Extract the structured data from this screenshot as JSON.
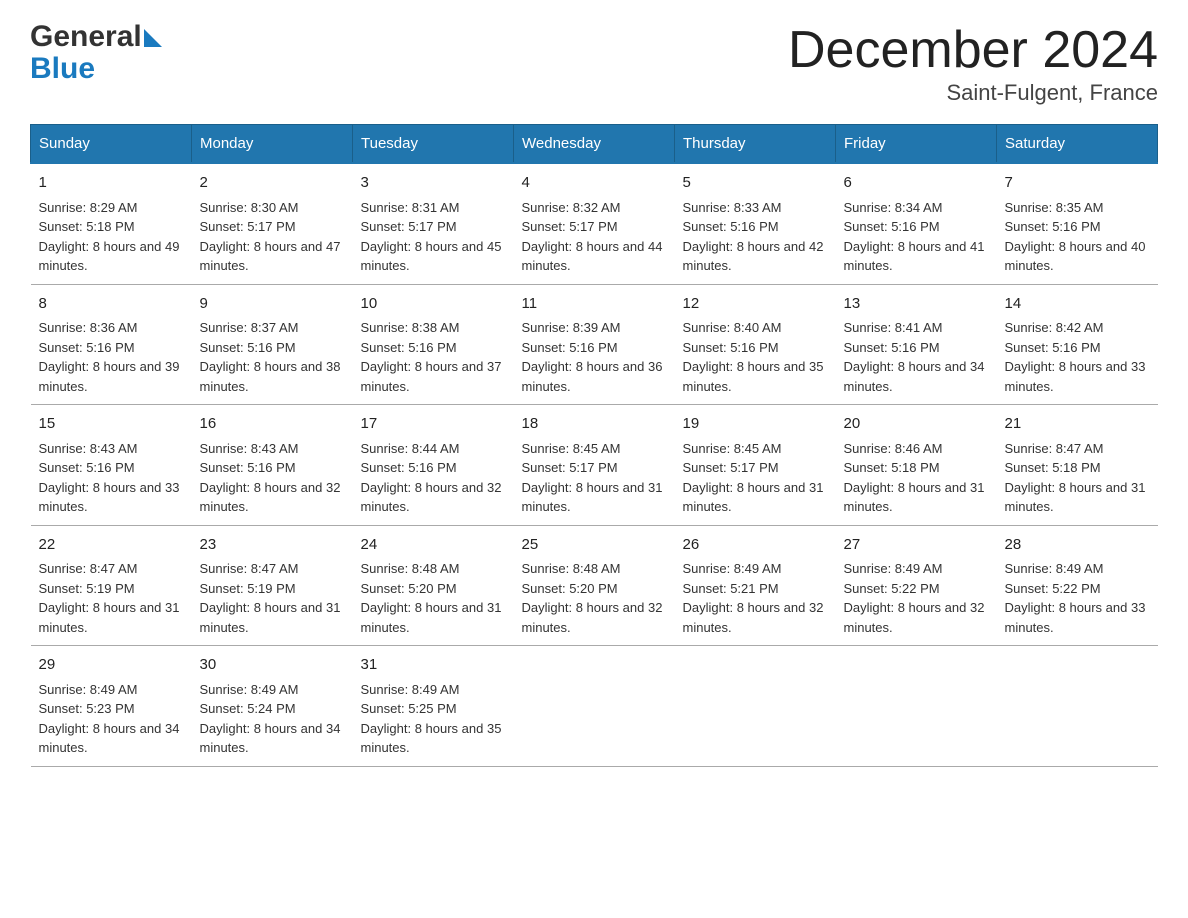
{
  "header": {
    "logo_general": "General",
    "logo_blue": "Blue",
    "title": "December 2024",
    "subtitle": "Saint-Fulgent, France"
  },
  "calendar": {
    "days_of_week": [
      "Sunday",
      "Monday",
      "Tuesday",
      "Wednesday",
      "Thursday",
      "Friday",
      "Saturday"
    ],
    "weeks": [
      [
        {
          "day": "1",
          "sunrise": "8:29 AM",
          "sunset": "5:18 PM",
          "daylight": "8 hours and 49 minutes."
        },
        {
          "day": "2",
          "sunrise": "8:30 AM",
          "sunset": "5:17 PM",
          "daylight": "8 hours and 47 minutes."
        },
        {
          "day": "3",
          "sunrise": "8:31 AM",
          "sunset": "5:17 PM",
          "daylight": "8 hours and 45 minutes."
        },
        {
          "day": "4",
          "sunrise": "8:32 AM",
          "sunset": "5:17 PM",
          "daylight": "8 hours and 44 minutes."
        },
        {
          "day": "5",
          "sunrise": "8:33 AM",
          "sunset": "5:16 PM",
          "daylight": "8 hours and 42 minutes."
        },
        {
          "day": "6",
          "sunrise": "8:34 AM",
          "sunset": "5:16 PM",
          "daylight": "8 hours and 41 minutes."
        },
        {
          "day": "7",
          "sunrise": "8:35 AM",
          "sunset": "5:16 PM",
          "daylight": "8 hours and 40 minutes."
        }
      ],
      [
        {
          "day": "8",
          "sunrise": "8:36 AM",
          "sunset": "5:16 PM",
          "daylight": "8 hours and 39 minutes."
        },
        {
          "day": "9",
          "sunrise": "8:37 AM",
          "sunset": "5:16 PM",
          "daylight": "8 hours and 38 minutes."
        },
        {
          "day": "10",
          "sunrise": "8:38 AM",
          "sunset": "5:16 PM",
          "daylight": "8 hours and 37 minutes."
        },
        {
          "day": "11",
          "sunrise": "8:39 AM",
          "sunset": "5:16 PM",
          "daylight": "8 hours and 36 minutes."
        },
        {
          "day": "12",
          "sunrise": "8:40 AM",
          "sunset": "5:16 PM",
          "daylight": "8 hours and 35 minutes."
        },
        {
          "day": "13",
          "sunrise": "8:41 AM",
          "sunset": "5:16 PM",
          "daylight": "8 hours and 34 minutes."
        },
        {
          "day": "14",
          "sunrise": "8:42 AM",
          "sunset": "5:16 PM",
          "daylight": "8 hours and 33 minutes."
        }
      ],
      [
        {
          "day": "15",
          "sunrise": "8:43 AM",
          "sunset": "5:16 PM",
          "daylight": "8 hours and 33 minutes."
        },
        {
          "day": "16",
          "sunrise": "8:43 AM",
          "sunset": "5:16 PM",
          "daylight": "8 hours and 32 minutes."
        },
        {
          "day": "17",
          "sunrise": "8:44 AM",
          "sunset": "5:16 PM",
          "daylight": "8 hours and 32 minutes."
        },
        {
          "day": "18",
          "sunrise": "8:45 AM",
          "sunset": "5:17 PM",
          "daylight": "8 hours and 31 minutes."
        },
        {
          "day": "19",
          "sunrise": "8:45 AM",
          "sunset": "5:17 PM",
          "daylight": "8 hours and 31 minutes."
        },
        {
          "day": "20",
          "sunrise": "8:46 AM",
          "sunset": "5:18 PM",
          "daylight": "8 hours and 31 minutes."
        },
        {
          "day": "21",
          "sunrise": "8:47 AM",
          "sunset": "5:18 PM",
          "daylight": "8 hours and 31 minutes."
        }
      ],
      [
        {
          "day": "22",
          "sunrise": "8:47 AM",
          "sunset": "5:19 PM",
          "daylight": "8 hours and 31 minutes."
        },
        {
          "day": "23",
          "sunrise": "8:47 AM",
          "sunset": "5:19 PM",
          "daylight": "8 hours and 31 minutes."
        },
        {
          "day": "24",
          "sunrise": "8:48 AM",
          "sunset": "5:20 PM",
          "daylight": "8 hours and 31 minutes."
        },
        {
          "day": "25",
          "sunrise": "8:48 AM",
          "sunset": "5:20 PM",
          "daylight": "8 hours and 32 minutes."
        },
        {
          "day": "26",
          "sunrise": "8:49 AM",
          "sunset": "5:21 PM",
          "daylight": "8 hours and 32 minutes."
        },
        {
          "day": "27",
          "sunrise": "8:49 AM",
          "sunset": "5:22 PM",
          "daylight": "8 hours and 32 minutes."
        },
        {
          "day": "28",
          "sunrise": "8:49 AM",
          "sunset": "5:22 PM",
          "daylight": "8 hours and 33 minutes."
        }
      ],
      [
        {
          "day": "29",
          "sunrise": "8:49 AM",
          "sunset": "5:23 PM",
          "daylight": "8 hours and 34 minutes."
        },
        {
          "day": "30",
          "sunrise": "8:49 AM",
          "sunset": "5:24 PM",
          "daylight": "8 hours and 34 minutes."
        },
        {
          "day": "31",
          "sunrise": "8:49 AM",
          "sunset": "5:25 PM",
          "daylight": "8 hours and 35 minutes."
        },
        null,
        null,
        null,
        null
      ]
    ]
  }
}
